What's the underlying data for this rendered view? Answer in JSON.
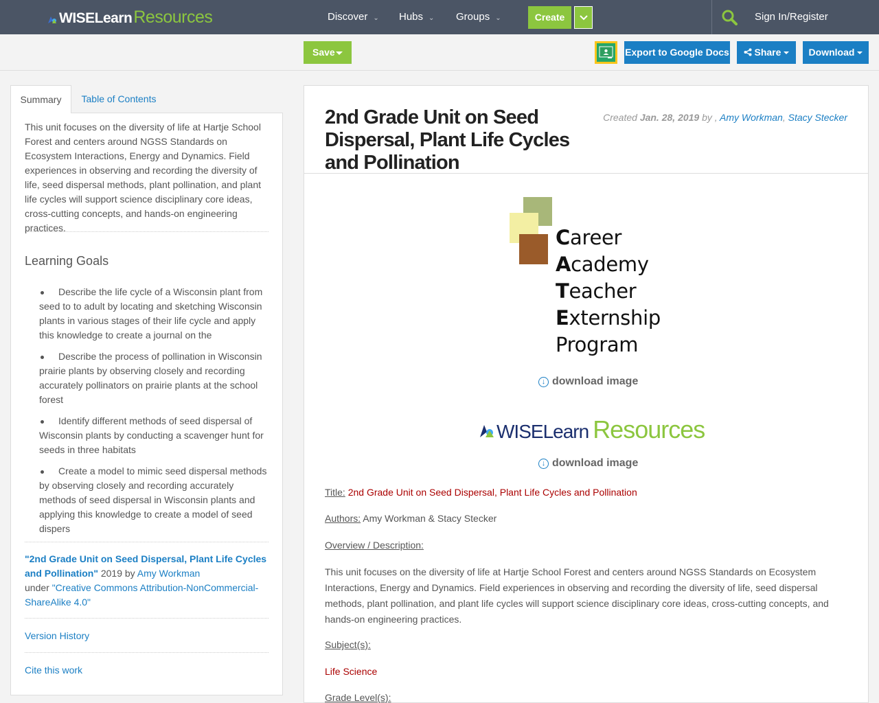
{
  "nav": {
    "logo_part1": "WISELearn",
    "logo_part2": "Resources",
    "discover": "Discover",
    "hubs": "Hubs",
    "groups": "Groups",
    "create": "Create",
    "signin": "Sign In/Register"
  },
  "toolbar": {
    "save": "Save",
    "export": "Export to Google Docs",
    "share": "Share",
    "download": "Download"
  },
  "tabs": {
    "summary": "Summary",
    "toc": "Table of Contents"
  },
  "left": {
    "summary": "This unit focuses on the diversity of life at Hartje School Forest and centers around NGSS Standards on Ecosystem Interactions, Energy and Dynamics. Field experiences in observing and recording the diversity of life, seed dispersal methods, plant pollination, and plant life cycles will support science disciplinary core ideas, cross-cutting concepts, and hands-on engineering practices.",
    "learning_goals_title": "Learning Goals",
    "goals": [
      "Describe the life cycle of a Wisconsin plant from seed to to adult by locating and sketching Wisconsin plants in various stages of their life cycle and apply this knowledge to create a journal on the",
      "Describe the process of pollination in Wisconsin prairie plants by observing closely and recording accurately pollinators on prairie plants at the school forest",
      "Identify different methods of seed dispersal of Wisconsin plants by conducting a scavenger hunt for seeds in three habitats",
      "Create a model to mimic seed dispersal methods by observing closely and recording accurately methods of seed dispersal in Wisconsin plants and applying this knowledge to create a model of seed dispers"
    ],
    "cite_title": "\"2nd Grade Unit on Seed Dispersal, Plant Life Cycles and Pollination\"",
    "cite_year": " 2019 by ",
    "cite_author": "Amy Workman",
    "cite_under": "under ",
    "cite_license": "\"Creative Commons Attribution-NonCommercial-ShareAlike 4.0\"",
    "version_history": "Version History",
    "cite_work": "Cite this work"
  },
  "main": {
    "title": "2nd Grade Unit on Seed Dispersal, Plant Life Cycles and Pollination",
    "created_label": "Created ",
    "created_date": "Jan. 28, 2019",
    "created_by": " by , ",
    "author1": "Amy Workman",
    "comma": ", ",
    "author2": "Stacy Stecker",
    "cate": {
      "c1": "C",
      "c2": "areer",
      "a1": "A",
      "a2": "cademy",
      "t1": "T",
      "t2": "eacher",
      "e1": "E",
      "e2": "xternship",
      "p": "Program"
    },
    "download_image": "download image",
    "wise2_part1": "WISE",
    "wise2_part1b": "Learn",
    "wise2_part2": "Resources",
    "title_label": "Title:",
    "title_value": " 2nd Grade Unit on Seed Dispersal, Plant Life Cycles and Pollination",
    "authors_label": "Authors:",
    "authors_value": " Amy Workman & Stacy Stecker",
    "overview_label": "Overview / Description:",
    "overview_text": "This unit focuses on the diversity of life at Hartje School Forest and centers around NGSS Standards on Ecosystem Interactions, Energy and Dynamics. Field experiences in observing and recording the diversity of life, seed dispersal methods, plant pollination, and plant life cycles will support science disciplinary core ideas, cross-cutting concepts, and hands-on engineering practices.",
    "subjects_label": "Subject(s):",
    "subject_value": "Life Science",
    "grade_label": "Grade Level(s):"
  },
  "colors": {
    "nav_bg": "#4b5565",
    "green": "#8cc63f",
    "blue": "#1b7fc4",
    "red": "#aa0000"
  },
  "icons": {
    "search": "search-icon",
    "share": "share-icon",
    "download_circle": "download-circle-icon",
    "classroom": "google-classroom-icon"
  }
}
